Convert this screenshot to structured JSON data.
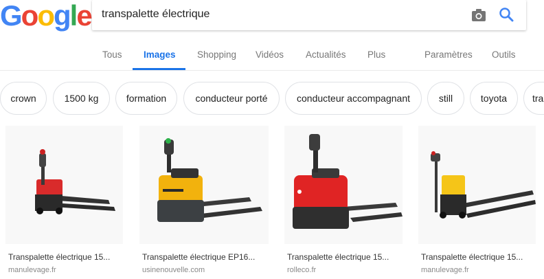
{
  "logo": {
    "letters": [
      "G",
      "o",
      "o",
      "g",
      "l",
      "e"
    ],
    "colors": [
      "#4285F4",
      "#EA4335",
      "#FBBC05",
      "#4285F4",
      "#34A853",
      "#EA4335"
    ]
  },
  "search": {
    "query": "transpalette électrique"
  },
  "tabs": [
    {
      "label": "Tous"
    },
    {
      "label": "Images"
    },
    {
      "label": "Shopping"
    },
    {
      "label": "Vidéos"
    },
    {
      "label": "Actualités"
    },
    {
      "label": "Plus"
    },
    {
      "label": "Paramètres"
    },
    {
      "label": "Outils"
    }
  ],
  "chips": [
    {
      "label": "crown"
    },
    {
      "label": "1500 kg"
    },
    {
      "label": "formation"
    },
    {
      "label": "conducteur porté"
    },
    {
      "label": "conducteur accompagnant"
    },
    {
      "label": "still"
    },
    {
      "label": "toyota"
    },
    {
      "label": "tra"
    }
  ],
  "results": [
    {
      "title": "Transpalette électrique 15...",
      "source": "manulevage.fr",
      "body_color": "#d92b2b"
    },
    {
      "title": "Transpalette électrique EP16...",
      "source": "usinenouvelle.com",
      "body_color": "#f2b20d"
    },
    {
      "title": "Transpalette électrique 15...",
      "source": "rolleco.fr",
      "body_color": "#e02424"
    },
    {
      "title": "Transpalette électrique 15...",
      "source": "manulevage.fr",
      "body_color": "#f5c518"
    }
  ],
  "colors": {
    "accent": "#1a73e8"
  }
}
